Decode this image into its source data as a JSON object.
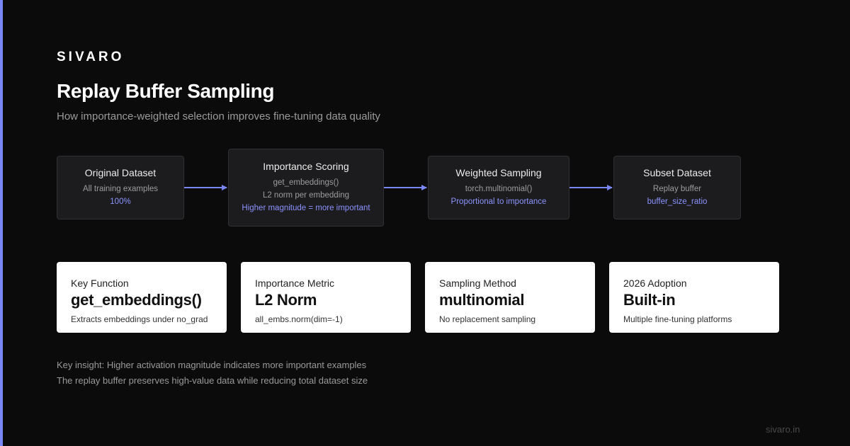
{
  "brand": "SIVARO",
  "title": "Replay Buffer Sampling",
  "subtitle": "How importance-weighted selection improves fine-tuning data quality",
  "colors": {
    "background": "#0b0b0b",
    "accent": "#7b86f5",
    "node_fill": "#1c1c1e",
    "card_fill": "#ffffff",
    "highlight_text": "#8b93ff"
  },
  "flow": [
    {
      "title": "Original Dataset",
      "lines": [
        "All training examples"
      ],
      "accent": "100%"
    },
    {
      "title": "Importance Scoring",
      "lines": [
        "get_embeddings()",
        "L2 norm per embedding"
      ],
      "accent": "Higher magnitude = more important"
    },
    {
      "title": "Weighted Sampling",
      "lines": [
        "torch.multinomial()"
      ],
      "accent": "Proportional to importance"
    },
    {
      "title": "Subset Dataset",
      "lines": [
        "Replay buffer"
      ],
      "accent": "buffer_size_ratio"
    }
  ],
  "cards": [
    {
      "label": "Key Function",
      "value": "get_embeddings()",
      "desc": "Extracts embeddings under no_grad"
    },
    {
      "label": "Importance Metric",
      "value": "L2 Norm",
      "desc": "all_embs.norm(dim=-1)"
    },
    {
      "label": "Sampling Method",
      "value": "multinomial",
      "desc": "No replacement sampling"
    },
    {
      "label": "2026 Adoption",
      "value": "Built-in",
      "desc": "Multiple fine-tuning platforms"
    }
  ],
  "insights": [
    "Key insight: Higher activation magnitude indicates more important examples",
    "The replay buffer preserves high-value data while reducing total dataset size"
  ],
  "footer": "sivaro.in"
}
